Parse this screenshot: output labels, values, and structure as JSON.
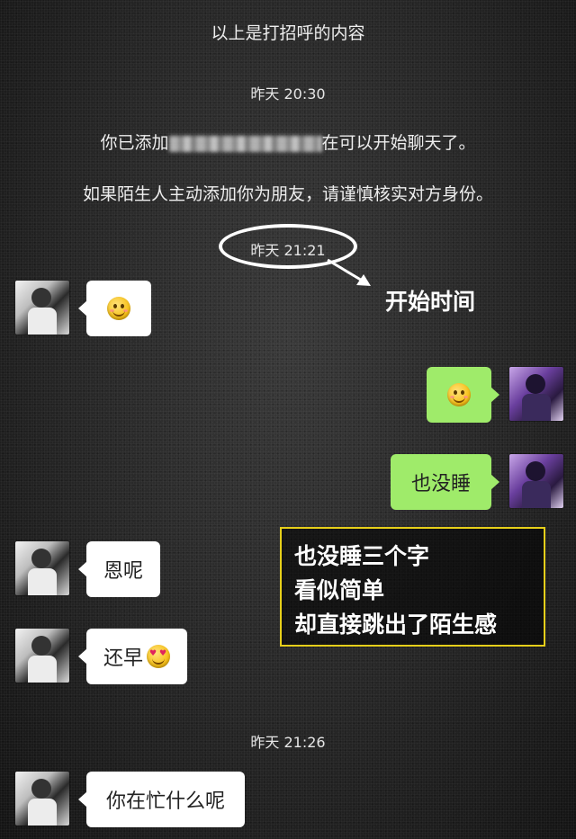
{
  "chat": {
    "greeting_note": "以上是打招呼的内容",
    "time_1": "昨天 20:30",
    "added_prefix": "你已添加",
    "added_suffix": "在可以开始聊天了。",
    "warning": "如果陌生人主动添加你为朋友，请谨慎核实对方身份。",
    "time_2": "昨天 21:21",
    "time_3": "昨天 21:26",
    "messages": [
      {
        "side": "left",
        "text": "",
        "emoji": "smile-emoji"
      },
      {
        "side": "right",
        "text": "",
        "emoji": "smile-emoji"
      },
      {
        "side": "right",
        "text": "也没睡"
      },
      {
        "side": "left",
        "text": "恩呢"
      },
      {
        "side": "left",
        "text": "还早",
        "emoji": "heart-eyes-emoji"
      },
      {
        "side": "left",
        "text": "你在忙什么呢"
      }
    ]
  },
  "annotations": {
    "start_time_label": "开始时间",
    "note_lines": [
      "也没睡三个字",
      "看似简单",
      "却直接跳出了陌生感"
    ],
    "colors": {
      "ellipse": "#ffffff",
      "box_border": "#e6cf1a",
      "green_bubble": "#9feb6a"
    }
  }
}
